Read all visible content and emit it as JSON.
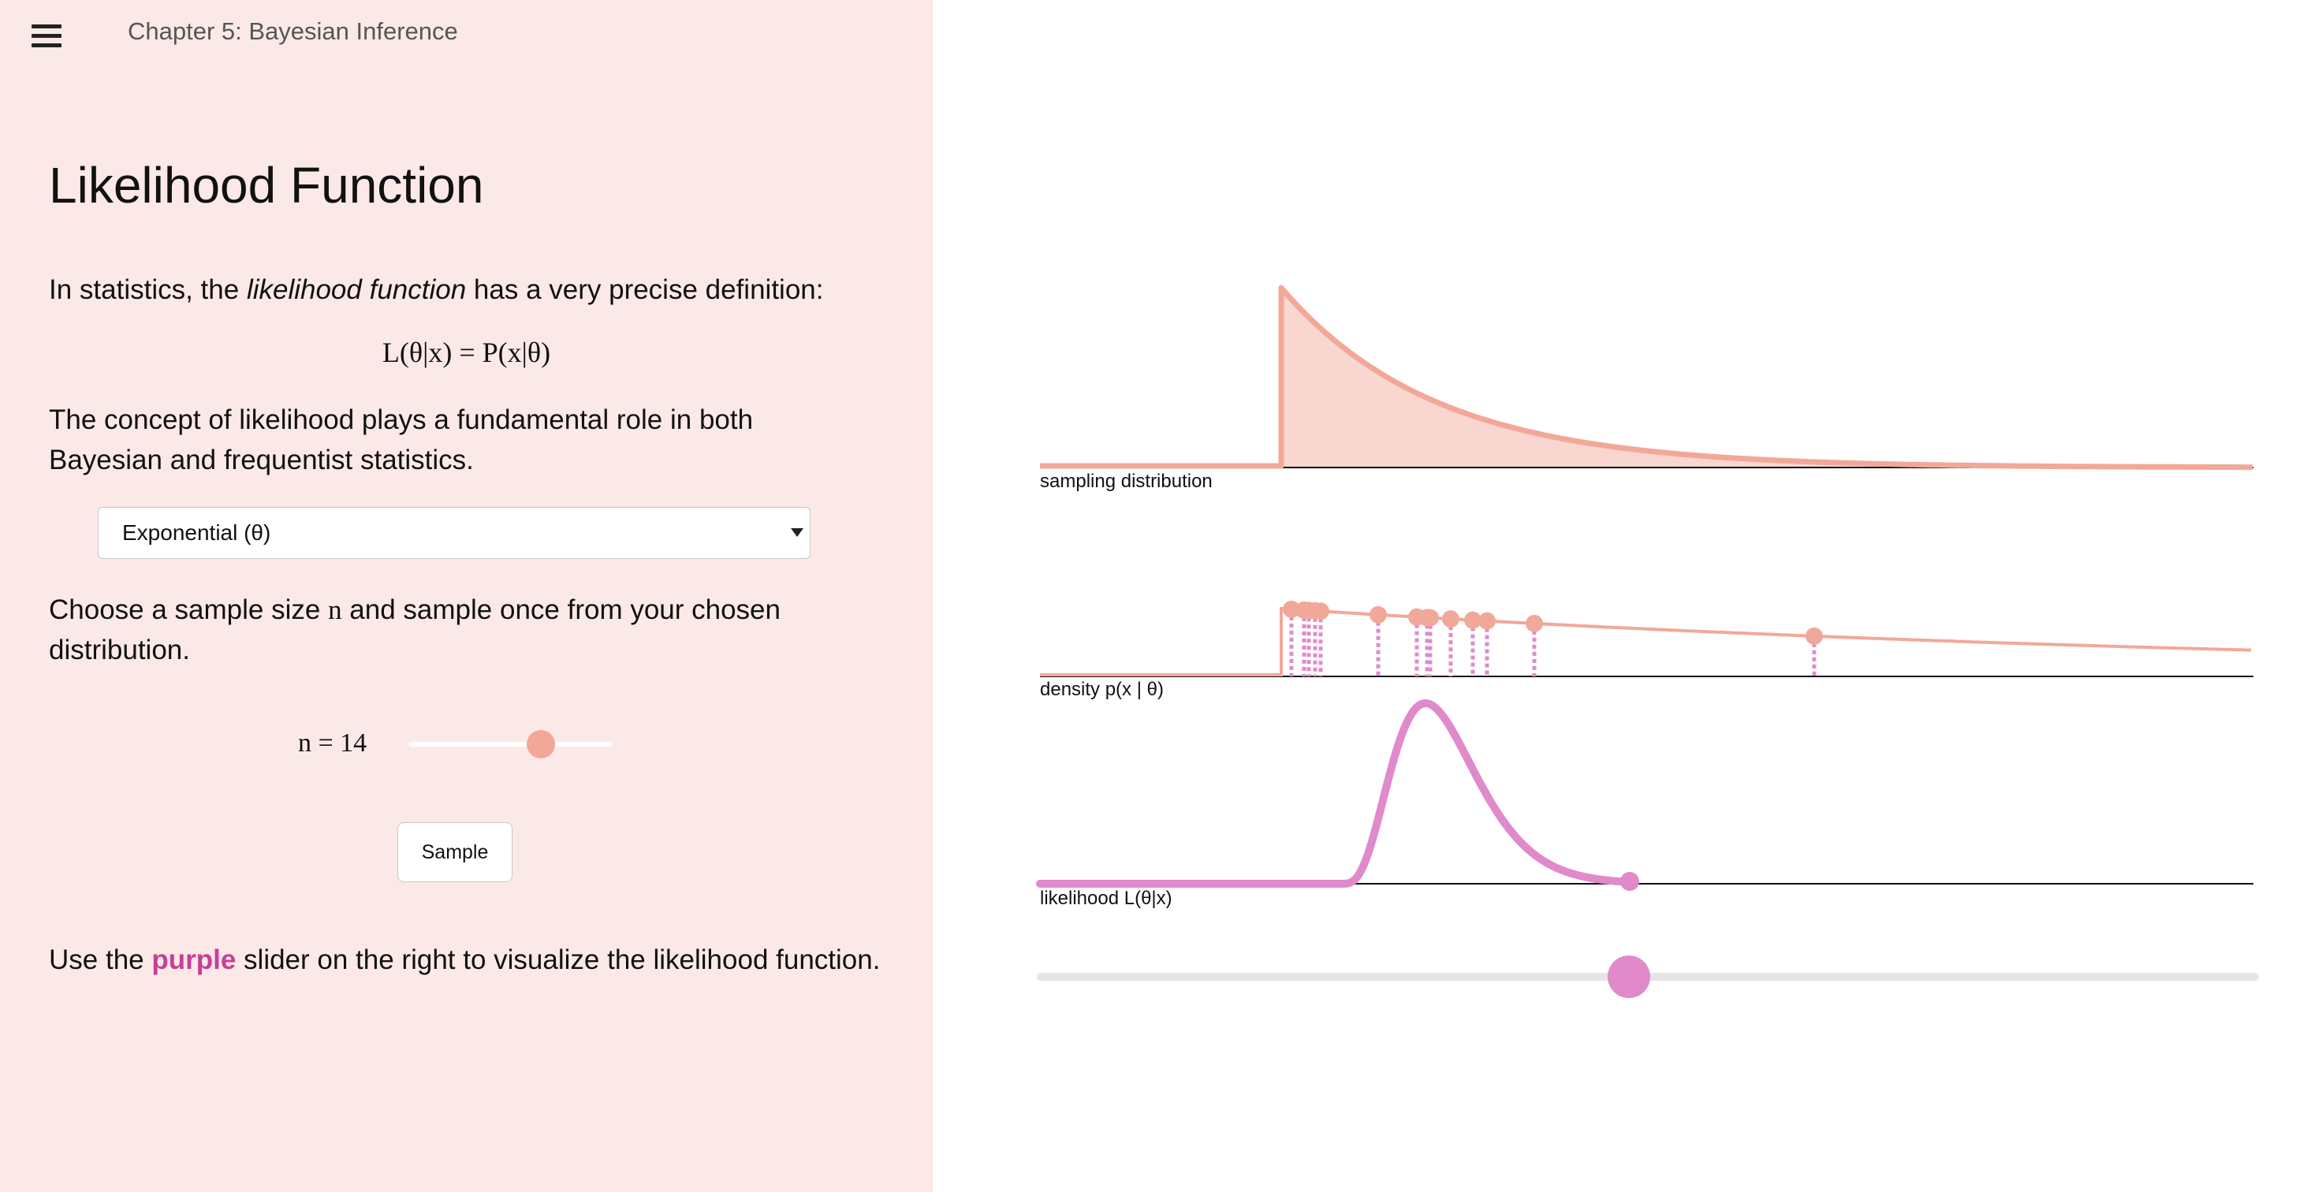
{
  "header": {
    "menu_icon": "hamburger-menu-icon",
    "chapter_title": "Chapter 5: Bayesian Inference"
  },
  "content": {
    "title": "Likelihood Function",
    "intro_before": "In statistics, the ",
    "intro_em": "likelihood function",
    "intro_after": " has a very precise definition:",
    "formula": "L(θ|x) = P(x|θ)",
    "concept_text": "The concept of likelihood plays a fundamental role in both Bayesian and frequentist statistics.",
    "distribution_select": {
      "selected": "Exponential (θ)"
    },
    "choose_before": "Choose a sample size ",
    "choose_var": "n",
    "choose_after": " and sample once from your chosen distribution.",
    "n_label": "n = 14",
    "n_value": 14,
    "sample_button": "Sample",
    "use_before": "Use the ",
    "use_purple": "purple",
    "use_after": " slider on the right to visualize the likelihood function."
  },
  "colors": {
    "left_panel_bg": "#fbe9e7",
    "sampling_stroke": "#f2a898",
    "sampling_fill": "#f9d6d0",
    "sample_points": "#f2a898",
    "sample_stems": "#e08acb",
    "likelihood": "#e08acb",
    "purple_text": "#c83e97"
  },
  "charts": {
    "sampling_caption": "sampling distribution",
    "density_caption": "density p(x | θ)",
    "likelihood_caption": "likelihood L(θ|x)"
  },
  "chart_data": [
    {
      "type": "area",
      "xlabel": "sampling distribution",
      "note": "exponential density with rate θ, starting at x = 0"
    },
    {
      "type": "scatter",
      "xlabel": "density p(x | θ)",
      "sample_size": 14
    },
    {
      "type": "line",
      "xlabel": "likelihood L(θ|x)",
      "theta_slider_fraction": 0.5
    }
  ]
}
